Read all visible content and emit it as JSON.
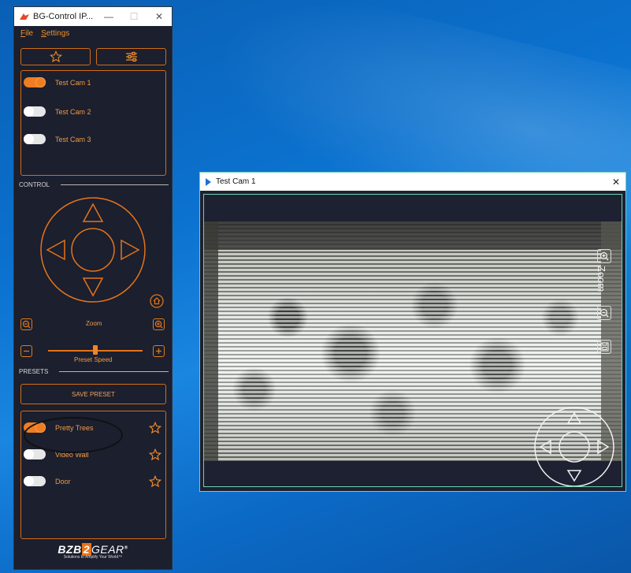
{
  "control_window": {
    "title": "BG-Control IP...",
    "controls": {
      "minimize": "—",
      "maximize": "☐",
      "close": "✕"
    },
    "menu": [
      "File",
      "Settings"
    ],
    "toolbar": {
      "favorites_icon": "star-icon",
      "settings_icon": "sliders-icon"
    },
    "cameras": [
      {
        "label": "Test Cam 1",
        "enabled": true
      },
      {
        "label": "Test Cam 2",
        "enabled": false
      },
      {
        "label": "Test Cam 3",
        "enabled": false
      }
    ],
    "control_section": "CONTROL",
    "zoom_label": "Zoom",
    "preset_speed_label": "Preset Speed",
    "preset_speed_level": 0.5,
    "presets_section": "PRESETS",
    "save_preset_label": "SAVE PRESET",
    "presets": [
      {
        "label": "Pretty Trees",
        "enabled": true
      },
      {
        "label": "Video Wall",
        "enabled": false
      },
      {
        "label": "Door",
        "enabled": false
      }
    ],
    "brand": {
      "logo_left": "BZB",
      "logo_mid": "2",
      "logo_right": "GEAR",
      "registered": "®",
      "tagline": "Solutions to Amplify Your World™"
    }
  },
  "camera_window": {
    "title": "Test Cam 1",
    "close": "✕",
    "zoom_label": "Zoom"
  },
  "colors": {
    "accent": "#ef7d22",
    "panel": "#1b1f2e",
    "desktop": "#0b72cf",
    "cam_border": "#6fd2b0"
  }
}
